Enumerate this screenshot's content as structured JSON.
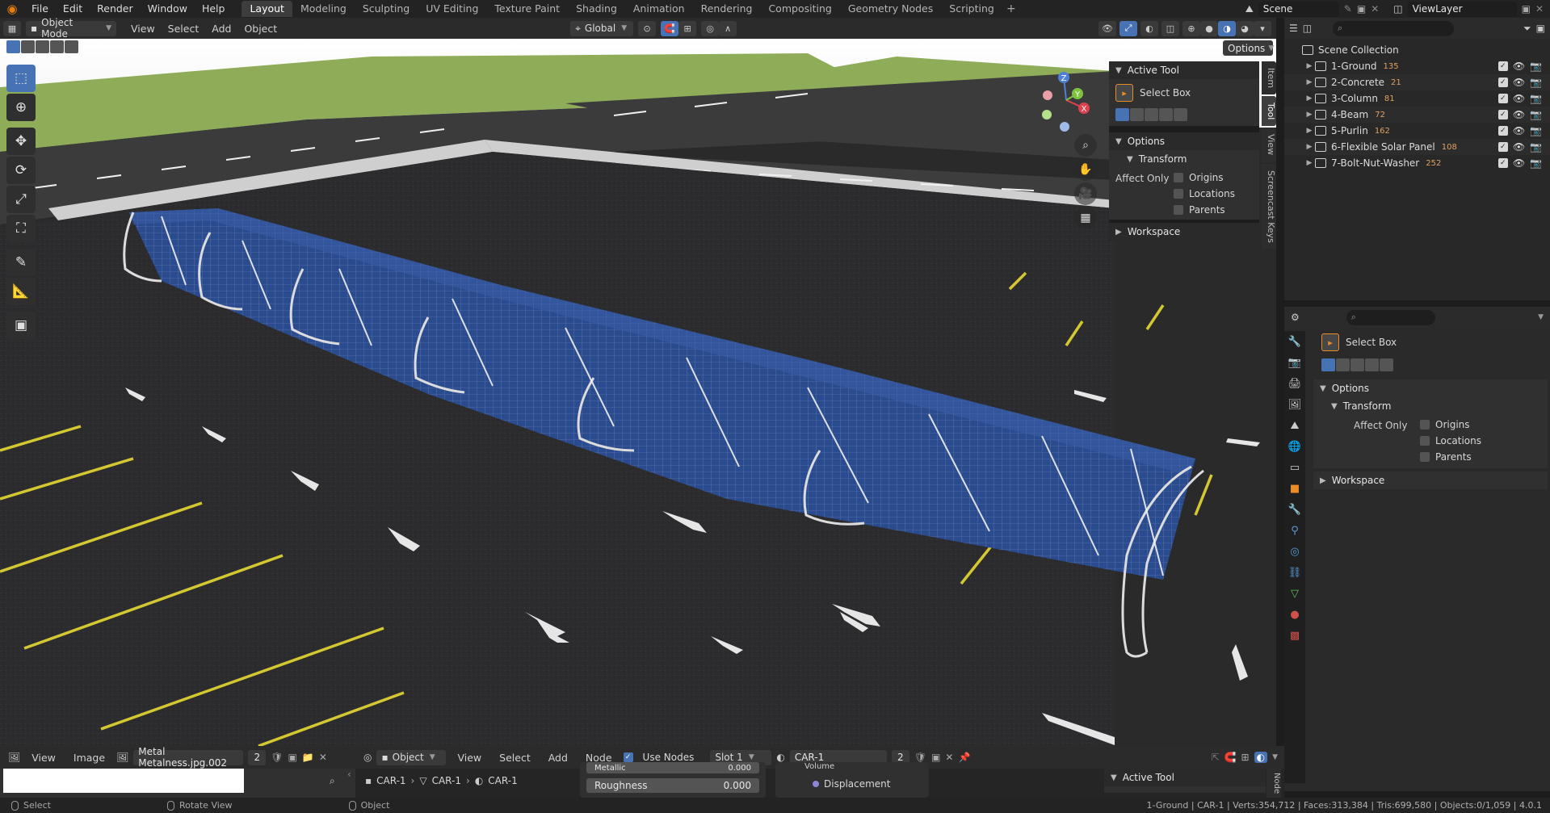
{
  "topbar": {
    "menus": [
      "File",
      "Edit",
      "Render",
      "Window",
      "Help"
    ],
    "workspaces": [
      "Layout",
      "Modeling",
      "Sculpting",
      "UV Editing",
      "Texture Paint",
      "Shading",
      "Animation",
      "Rendering",
      "Compositing",
      "Geometry Nodes",
      "Scripting"
    ],
    "active_workspace": "Layout",
    "scene": "Scene",
    "view_layer": "ViewLayer"
  },
  "viewport_header": {
    "mode": "Object Mode",
    "menus": [
      "View",
      "Select",
      "Add",
      "Object"
    ],
    "orientation": "Global",
    "options": "Options"
  },
  "toolbar": {
    "icons": [
      "select-box-icon",
      "cursor-icon",
      "move-icon",
      "rotate-icon",
      "scale-icon",
      "transform-icon",
      "annotate-icon",
      "measure-icon",
      "add-cube-icon"
    ]
  },
  "gizmo": {
    "x": "X",
    "y": "Y",
    "z": "Z"
  },
  "npanel": {
    "active_tool_title": "Active Tool",
    "tool_name": "Select Box",
    "options_title": "Options",
    "transform_title": "Transform",
    "affect_only": "Affect Only",
    "checks": [
      "Origins",
      "Locations",
      "Parents"
    ],
    "workspace": "Workspace",
    "tabs": [
      "Item",
      "Tool",
      "View",
      "Screencast Keys"
    ]
  },
  "outliner": {
    "root": "Scene Collection",
    "items": [
      {
        "name": "1-Ground",
        "count": "135"
      },
      {
        "name": "2-Concrete",
        "count": "21"
      },
      {
        "name": "3-Column",
        "count": "81"
      },
      {
        "name": "4-Beam",
        "count": "72"
      },
      {
        "name": "5-Purlin",
        "count": "162"
      },
      {
        "name": "6-Flexible Solar Panel",
        "count": "108"
      },
      {
        "name": "7-Bolt-Nut-Washer",
        "count": "252"
      }
    ]
  },
  "properties": {
    "tool_name": "Select Box",
    "options": "Options",
    "transform": "Transform",
    "affect_only": "Affect Only",
    "checks": [
      "Origins",
      "Locations",
      "Parents"
    ],
    "workspace": "Workspace"
  },
  "image_editor": {
    "menus": [
      "View",
      "Image"
    ],
    "image_name": "Metal Metalness.jpg.002",
    "users": "2"
  },
  "shader_editor": {
    "object_dd": "Object",
    "menus": [
      "View",
      "Select",
      "Add",
      "Node"
    ],
    "use_nodes": "Use Nodes",
    "slot": "Slot 1",
    "material": "CAR-1",
    "material_users": "2",
    "breadcrumb": [
      "CAR-1",
      "CAR-1",
      "CAR-1"
    ],
    "metallic_label": "Metallic",
    "metallic_value": "0.000",
    "roughness_label": "Roughness",
    "roughness_value": "0.000",
    "displacement": "Displacement",
    "volume": "Volume",
    "active_tool": "Active Tool",
    "side_tab": "Node"
  },
  "statusbar": {
    "select": "Select",
    "rotate": "Rotate View",
    "object": "Object",
    "stats": "1-Ground | CAR-1 | Verts:354,712 | Faces:313,384 | Tris:699,580 | Objects:0/1,059 | 4.0.1"
  },
  "colors": {
    "accent_blue": "#4772b3",
    "asphalt": "#2d2d2e",
    "grass": "#8cab57",
    "parking_line": "#d3c832",
    "solar_blue": "#25438a"
  }
}
